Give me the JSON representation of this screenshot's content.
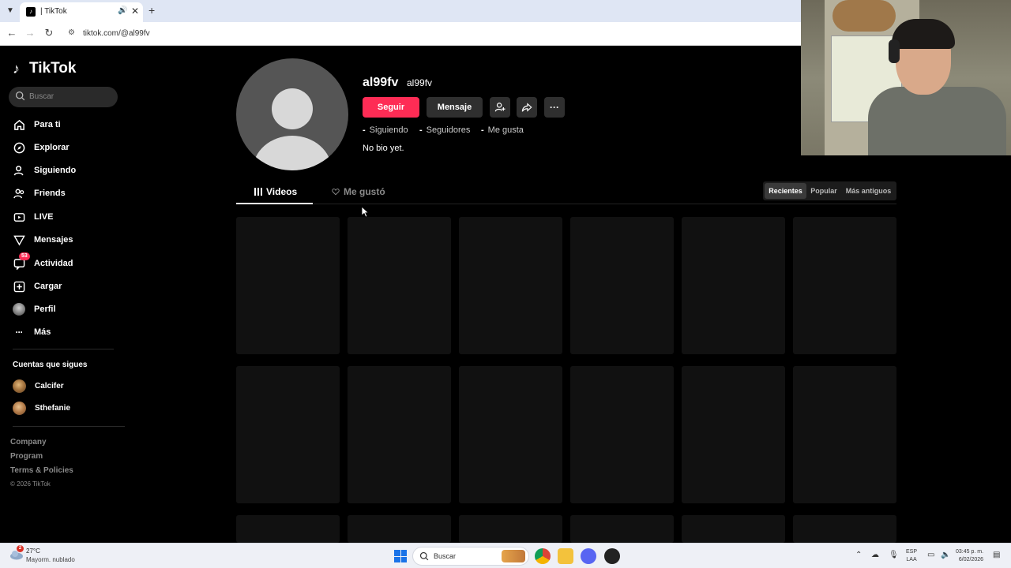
{
  "browser": {
    "tab_title": "| TikTok",
    "url": "tiktok.com/@al99fv"
  },
  "sidebar": {
    "logo_text": "TikTok",
    "search_placeholder": "Buscar",
    "nav": [
      {
        "label": "Para ti",
        "icon": "home-icon"
      },
      {
        "label": "Explorar",
        "icon": "compass-icon"
      },
      {
        "label": "Siguiendo",
        "icon": "user-follow-icon"
      },
      {
        "label": "Friends",
        "icon": "friends-icon"
      },
      {
        "label": "LIVE",
        "icon": "live-icon"
      },
      {
        "label": "Mensajes",
        "icon": "message-icon"
      },
      {
        "label": "Actividad",
        "icon": "activity-icon",
        "badge": "53"
      },
      {
        "label": "Cargar",
        "icon": "upload-icon"
      },
      {
        "label": "Perfil",
        "icon": "profile-avatar"
      },
      {
        "label": "Más",
        "icon": "more-icon"
      }
    ],
    "following_title": "Cuentas que sigues",
    "following": [
      "Calcifer",
      "Sthefanie"
    ],
    "footer": [
      "Company",
      "Program",
      "Terms & Policies"
    ],
    "copyright": "© 2026 TikTok"
  },
  "profile": {
    "username": "al99fv",
    "nickname": "al99fv",
    "follow_label": "Seguir",
    "message_label": "Mensaje",
    "stats": [
      {
        "value": "-",
        "label": "Siguiendo"
      },
      {
        "value": "-",
        "label": "Seguidores"
      },
      {
        "value": "-",
        "label": "Me gusta"
      }
    ],
    "bio": "No bio yet.",
    "tabs": [
      "Videos",
      "Me gustó"
    ],
    "sort": [
      "Recientes",
      "Popular",
      "Más antiguos"
    ]
  },
  "taskbar": {
    "weather_temp": "27°C",
    "weather_desc": "Mayorm. nublado",
    "weather_badge": "2",
    "search_label": "Buscar",
    "lang_line1": "ESP",
    "lang_line2": "LAA",
    "time": "03:45 p. m.",
    "date": "6/02/2026"
  },
  "colors": {
    "accent": "#fe2c55",
    "background": "#000000",
    "surface": "#2f2f2f"
  }
}
